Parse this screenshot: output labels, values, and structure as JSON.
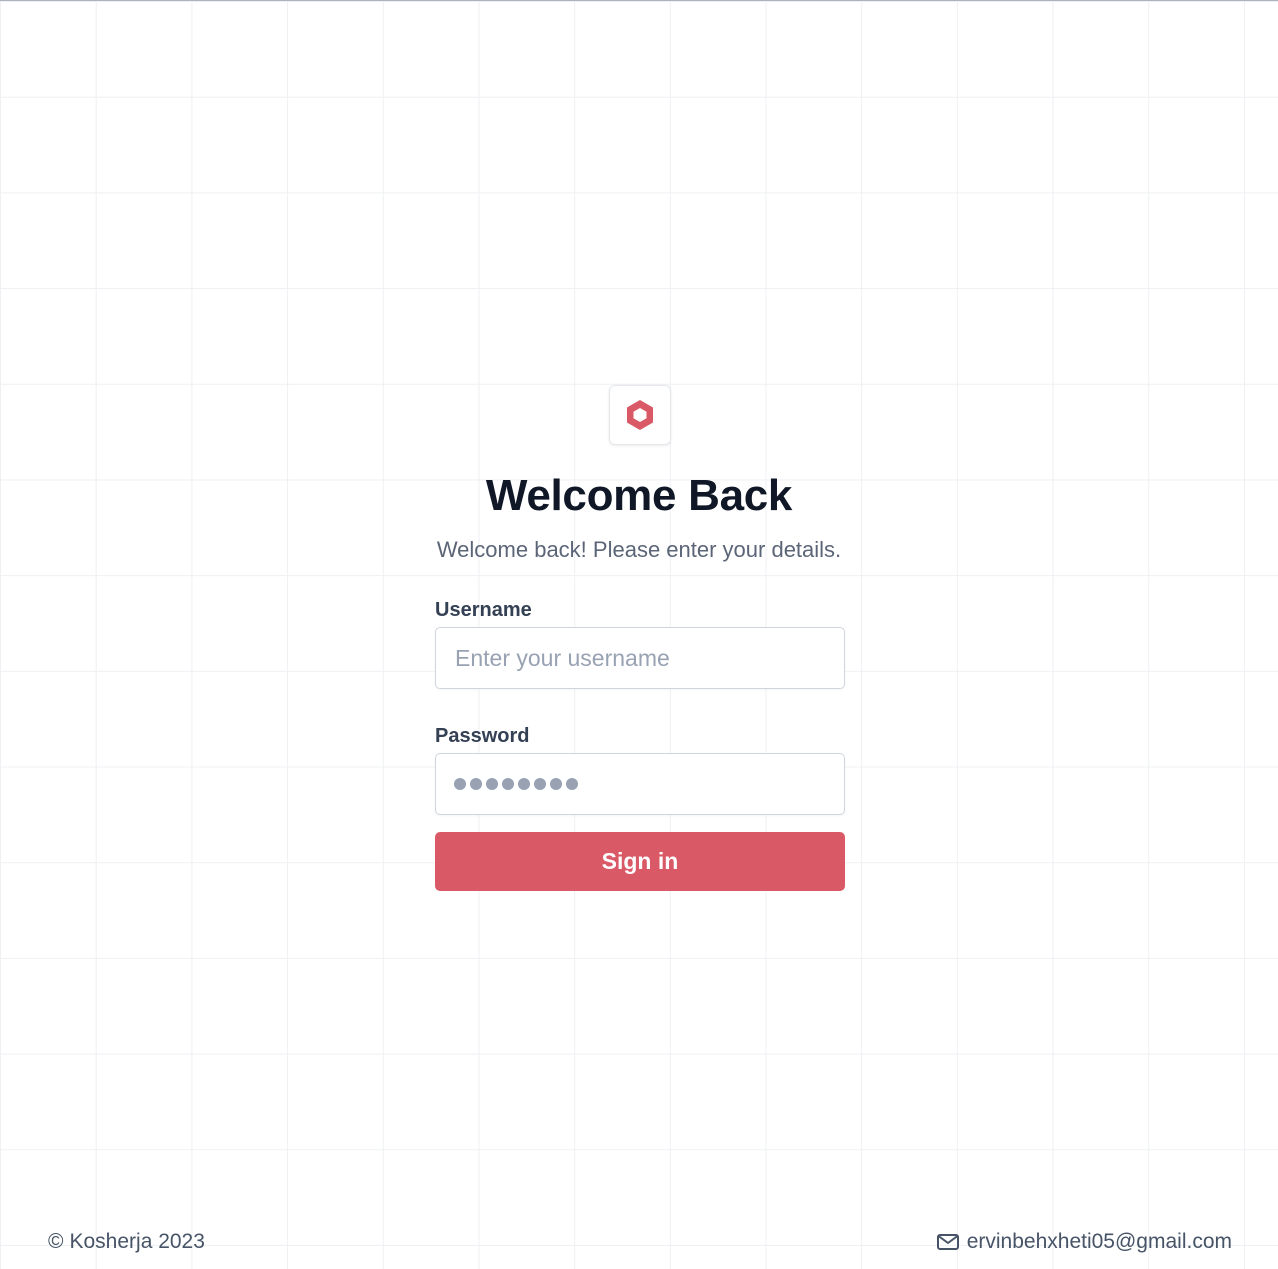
{
  "brand": {
    "logo_icon": "hexagon-icon",
    "accent_color": "#d95966"
  },
  "header": {
    "title": "Welcome Back",
    "subtitle": "Welcome back! Please enter your details."
  },
  "form": {
    "username": {
      "label": "Username",
      "placeholder": "Enter your username",
      "value": ""
    },
    "password": {
      "label": "Password",
      "placeholder": "••••••••",
      "value": ""
    },
    "submit_label": "Sign in"
  },
  "footer": {
    "copyright_symbol": "©",
    "copyright_text": "Kosherja 2023",
    "email_icon": "mail-icon",
    "email": "ervinbehxheti05@gmail.com"
  }
}
